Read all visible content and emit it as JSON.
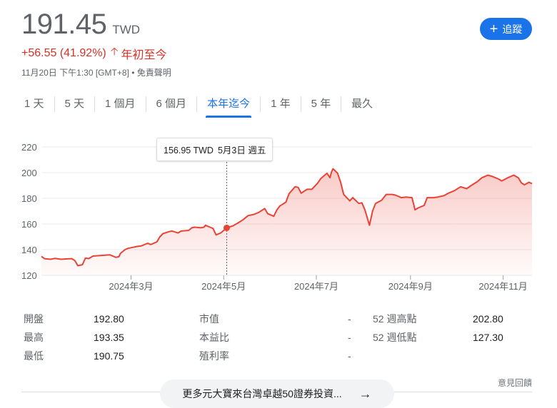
{
  "quote": {
    "price": "191.45",
    "currency": "TWD",
    "change": "+56.55 (41.92%)",
    "change_arrow": "arrow-up-icon",
    "period_label": "年初至今",
    "timestamp": "11月20日 下午1:30 [GMT+8]",
    "disclaimer": "• 免責聲明"
  },
  "follow_button": {
    "label": "追蹤",
    "icon": "plus-icon"
  },
  "tabs": [
    {
      "label": "1 天"
    },
    {
      "label": "5 天"
    },
    {
      "label": "1 個月"
    },
    {
      "label": "6 個月"
    },
    {
      "label": "本年迄今",
      "active": true
    },
    {
      "label": "1 年"
    },
    {
      "label": "5 年"
    },
    {
      "label": "最久"
    }
  ],
  "tooltip": {
    "price": "156.95 TWD",
    "date": "5月3日 週五"
  },
  "colors": {
    "line": "#ea4335",
    "accent": "#1a73e8",
    "down_up_text": "#d93025"
  },
  "chart_data": {
    "type": "line",
    "ylim": [
      120,
      220
    ],
    "yticks": [
      "120",
      "140",
      "160",
      "180",
      "200",
      "220"
    ],
    "xticks": [
      "2024年3月",
      "2024年5月",
      "2024年7月",
      "2024年9月",
      "2024年11月"
    ],
    "xtick_dates": [
      "2024-03-01",
      "2024-05-01",
      "2024-07-01",
      "2024-09-01",
      "2024-11-01"
    ],
    "grid": true,
    "hover_date": "2024-05-03",
    "hover_value": 156.95,
    "series": [
      {
        "points": [
          [
            "2024-01-02",
            134.8
          ],
          [
            "2024-01-04",
            133
          ],
          [
            "2024-01-08",
            132.5
          ],
          [
            "2024-01-11",
            133.2
          ],
          [
            "2024-01-15",
            132.5
          ],
          [
            "2024-01-18",
            132.8
          ],
          [
            "2024-01-22",
            133
          ],
          [
            "2024-01-24",
            131.5
          ],
          [
            "2024-01-26",
            127.5
          ],
          [
            "2024-01-29",
            128.3
          ],
          [
            "2024-01-31",
            133.5
          ],
          [
            "2024-02-02",
            133
          ],
          [
            "2024-02-05",
            135
          ],
          [
            "2024-02-16",
            136
          ],
          [
            "2024-02-20",
            134
          ],
          [
            "2024-02-22",
            134.5
          ],
          [
            "2024-02-23",
            137
          ],
          [
            "2024-02-26",
            140
          ],
          [
            "2024-02-28",
            141
          ],
          [
            "2024-03-01",
            141.5
          ],
          [
            "2024-03-05",
            142.5
          ],
          [
            "2024-03-08",
            143
          ],
          [
            "2024-03-12",
            145
          ],
          [
            "2024-03-14",
            144
          ],
          [
            "2024-03-18",
            146
          ],
          [
            "2024-03-20",
            150
          ],
          [
            "2024-03-22",
            152.5
          ],
          [
            "2024-03-26",
            154
          ],
          [
            "2024-03-28",
            154.5
          ],
          [
            "2024-04-01",
            153
          ],
          [
            "2024-04-03",
            154.5
          ],
          [
            "2024-04-08",
            155
          ],
          [
            "2024-04-10",
            157
          ],
          [
            "2024-04-12",
            157.5
          ],
          [
            "2024-04-16",
            157
          ],
          [
            "2024-04-18",
            157.5
          ],
          [
            "2024-04-19",
            159
          ],
          [
            "2024-04-22",
            157.5
          ],
          [
            "2024-04-24",
            156.5
          ],
          [
            "2024-04-26",
            151.5
          ],
          [
            "2024-04-29",
            153
          ],
          [
            "2024-05-03",
            156.95
          ],
          [
            "2024-05-07",
            158.5
          ],
          [
            "2024-05-10",
            160.5
          ],
          [
            "2024-05-14",
            163.5
          ],
          [
            "2024-05-17",
            166.5
          ],
          [
            "2024-05-21",
            167.5
          ],
          [
            "2024-05-24",
            169
          ],
          [
            "2024-05-28",
            172
          ],
          [
            "2024-05-30",
            168
          ],
          [
            "2024-06-03",
            166
          ],
          [
            "2024-06-05",
            171
          ],
          [
            "2024-06-07",
            174
          ],
          [
            "2024-06-11",
            177
          ],
          [
            "2024-06-13",
            183.5
          ],
          [
            "2024-06-17",
            189
          ],
          [
            "2024-06-19",
            188.5
          ],
          [
            "2024-06-21",
            184
          ],
          [
            "2024-06-25",
            187
          ],
          [
            "2024-06-28",
            187
          ],
          [
            "2024-07-02",
            192
          ],
          [
            "2024-07-04",
            195.5
          ],
          [
            "2024-07-08",
            199.5
          ],
          [
            "2024-07-10",
            196
          ],
          [
            "2024-07-11",
            200.5
          ],
          [
            "2024-07-12",
            203
          ],
          [
            "2024-07-15",
            199.5
          ],
          [
            "2024-07-17",
            192.5
          ],
          [
            "2024-07-19",
            183
          ],
          [
            "2024-07-23",
            178
          ],
          [
            "2024-07-25",
            180.5
          ],
          [
            "2024-07-29",
            176
          ],
          [
            "2024-07-31",
            176.5
          ],
          [
            "2024-08-02",
            171
          ],
          [
            "2024-08-05",
            159
          ],
          [
            "2024-08-07",
            170
          ],
          [
            "2024-08-09",
            176
          ],
          [
            "2024-08-13",
            178.5
          ],
          [
            "2024-08-16",
            183
          ],
          [
            "2024-08-20",
            183
          ],
          [
            "2024-08-22",
            182.5
          ],
          [
            "2024-08-26",
            180.5
          ],
          [
            "2024-08-29",
            181
          ],
          [
            "2024-09-02",
            180.5
          ],
          [
            "2024-09-04",
            171
          ],
          [
            "2024-09-06",
            172.5
          ],
          [
            "2024-09-10",
            174.5
          ],
          [
            "2024-09-12",
            180.5
          ],
          [
            "2024-09-16",
            180.5
          ],
          [
            "2024-09-19",
            181
          ],
          [
            "2024-09-23",
            182
          ],
          [
            "2024-09-26",
            184
          ],
          [
            "2024-09-30",
            186
          ],
          [
            "2024-10-04",
            189
          ],
          [
            "2024-10-08",
            187.5
          ],
          [
            "2024-10-11",
            190
          ],
          [
            "2024-10-15",
            193
          ],
          [
            "2024-10-18",
            196
          ],
          [
            "2024-10-22",
            198
          ],
          [
            "2024-10-25",
            197
          ],
          [
            "2024-10-29",
            195
          ],
          [
            "2024-10-31",
            193.5
          ],
          [
            "2024-11-04",
            196
          ],
          [
            "2024-11-08",
            198
          ],
          [
            "2024-11-11",
            196
          ],
          [
            "2024-11-13",
            192
          ],
          [
            "2024-11-15",
            190.5
          ],
          [
            "2024-11-18",
            192.5
          ],
          [
            "2024-11-20",
            191.45
          ]
        ]
      }
    ]
  },
  "stats": {
    "rows": [
      {
        "l1": "開盤",
        "v1": "192.80",
        "l2": "市值",
        "v2": "-",
        "l3": "52 週高點",
        "v3": "202.80"
      },
      {
        "l1": "最高",
        "v1": "193.35",
        "l2": "本益比",
        "v2": "-",
        "l3": "52 週低點",
        "v3": "127.30"
      },
      {
        "l1": "最低",
        "v1": "190.75",
        "l2": "殖利率",
        "v2": "-",
        "l3": "",
        "v3": ""
      }
    ]
  },
  "feedback": "意見回饋",
  "more_link": {
    "label": "更多元大寶來台灣卓越50證券投資...",
    "icon": "arrow-right-icon"
  }
}
